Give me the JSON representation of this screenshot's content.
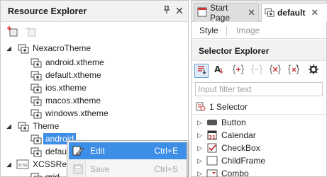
{
  "resource_explorer": {
    "title": "Resource Explorer",
    "pin_icon": "pin-icon",
    "close_icon": "close-icon",
    "toolbar": [
      "add-resource-icon",
      "remove-resource-icon"
    ],
    "tree": {
      "nexacro_theme": {
        "label": "NexacroTheme",
        "children": [
          "android.xtheme",
          "default.xtheme",
          "ios.xtheme",
          "macos.xtheme",
          "windows.xtheme"
        ]
      },
      "theme": {
        "label": "Theme",
        "children": [
          "android",
          "defau"
        ]
      },
      "xcss": {
        "label": "XCSSRes",
        "prefix": "XCSS",
        "children": [
          "grid"
        ]
      }
    }
  },
  "editor": {
    "tabs": [
      {
        "label": "Start Page",
        "close": "✕"
      },
      {
        "label": "default",
        "close": "✕"
      }
    ],
    "subtabs": [
      "Style",
      "Image"
    ]
  },
  "selector_explorer": {
    "title": "Selector Explorer",
    "filter_placeholder": "Input filter text",
    "count_label": "1 Selector",
    "toolbar_icons": [
      "sort-icon",
      "font-size-icon",
      "add-selector-icon",
      "remove-selector-icon",
      "expand-selector-icon",
      "collapse-selector-icon",
      "settings-icon"
    ],
    "font_button_label": "A",
    "components": [
      "Button",
      "Calendar",
      "CheckBox",
      "ChildFrame",
      "Combo"
    ]
  },
  "context_menu": {
    "items": [
      {
        "label": "Edit",
        "shortcut": "Ctrl+E",
        "enabled": true
      },
      {
        "label": "Save",
        "shortcut": "Ctrl+S",
        "enabled": false
      }
    ]
  },
  "colors": {
    "selection": "#3d8ee6",
    "panel_header": "#f2f2f2"
  }
}
